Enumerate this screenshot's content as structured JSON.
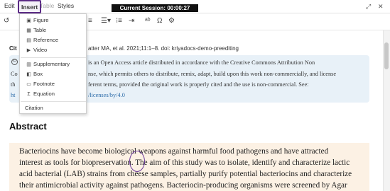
{
  "menubar": {
    "items": [
      "Edit",
      "Insert",
      "Table",
      "Styles"
    ],
    "session": "Current Session: 00:00:27",
    "controls": [
      "⤢",
      "✕"
    ]
  },
  "toolbar": {
    "icons": [
      "undo-icon",
      "align-left-icon",
      "list-icon",
      "list-ordered-icon",
      "indent-icon",
      "outdent-icon",
      "spellcheck-icon",
      "special-char-icon",
      "source-code-icon"
    ]
  },
  "insert_menu": {
    "items": [
      "Figure",
      "Table",
      "Reference",
      "Video",
      "Supplementary",
      "Box",
      "Footnote",
      "Equation",
      "Citation"
    ]
  },
  "document": {
    "citation_label": "Cit",
    "citation_text": "atter MA, et al. 2021;11:1–8. doi: kriyadocs-demo-preediting",
    "license_lines": [
      "is an Open Access article distributed in accordance with the Creative Commons Attribution Non",
      "nse, which permits others to distribute, remix, adapt, build upon this work non-commercially, and license",
      "ferent terms, provided the original work is properly cited and the use is non-commercial. See:",
      "/licenses/by/4.0"
    ],
    "license_prefix_lines": [
      "C",
      "Co",
      "th",
      "ht"
    ],
    "abstract_heading": "Abstract",
    "abstract_lines": [
      "Bacteriocins have become biological weapons against harmful food pathogens and have attracted",
      "interest as tools for biopreservation. The aim of this study was to isolate, identify and characterize lactic",
      "acid bacterial (LAB) strains from cheese samples, partially purify potential bacteriocins and characterize",
      "their antimicrobial activity against pathogens. Bacteriocin-producing organisms were screened by Agar"
    ]
  },
  "colors": {
    "accent": "#5b2a86",
    "license_bg": "#e8f1f8",
    "abstract_bg": "#fcf1e4",
    "link": "#2a6aa8"
  }
}
